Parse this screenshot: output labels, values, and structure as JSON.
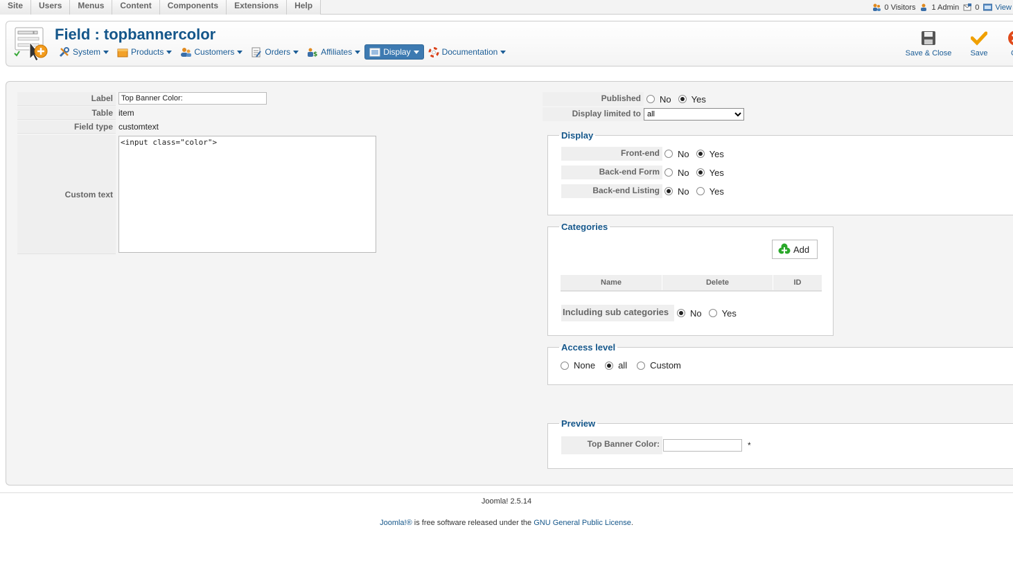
{
  "topmenu": [
    "Site",
    "Users",
    "Menus",
    "Content",
    "Components",
    "Extensions",
    "Help"
  ],
  "status": {
    "visitors": "0 Visitors",
    "admins": "1 Admin",
    "messages": "0",
    "view": "View"
  },
  "header": {
    "title": "Field : topbannercolor",
    "submenu": [
      "System",
      "Products",
      "Customers",
      "Orders",
      "Affiliates",
      "Display",
      "Documentation"
    ],
    "active_submenu": "Display"
  },
  "toolbar": {
    "save_close": "Save & Close",
    "save": "Save",
    "cancel": "Ca"
  },
  "form": {
    "label_key": "Label",
    "label_value": "Top Banner Color:",
    "table_key": "Table",
    "table_value": "item",
    "field_type_key": "Field type",
    "field_type_value": "customtext",
    "custom_text_key": "Custom text",
    "custom_text_value": "<input class=\"color\">"
  },
  "right": {
    "published_key": "Published",
    "published": {
      "no": "No",
      "yes": "Yes",
      "selected": "Yes"
    },
    "display_limited_key": "Display limited to",
    "display_limited_value": "all",
    "display_legend": "Display",
    "frontend_key": "Front-end",
    "frontend_selected": "Yes",
    "backend_form_key": "Back-end Form",
    "backend_form_selected": "Yes",
    "backend_listing_key": "Back-end Listing",
    "backend_listing_selected": "No",
    "no": "No",
    "yes": "Yes",
    "categories_legend": "Categories",
    "add_button": "Add",
    "cat_columns": [
      "Name",
      "Delete",
      "ID"
    ],
    "including_sub_key": "Including sub categories",
    "including_sub_selected": "No",
    "access_legend": "Access level",
    "access_options": [
      "None",
      "all",
      "Custom"
    ],
    "access_selected": "all",
    "preview_legend": "Preview",
    "preview_key": "Top Banner Color:",
    "preview_value": "",
    "preview_required": "*"
  },
  "footer": {
    "version": "Joomla! 2.5.14",
    "joomla_link": "Joomla!®",
    "license_text_1": " is free software released under the ",
    "license_link": "GNU General Public License",
    "license_text_2": "."
  },
  "colors": {
    "title": "#14568a",
    "link": "#1a5c96",
    "active_tab": "#3d7ab1",
    "save_check": "#f0a000",
    "cancel": "#e04a1a"
  }
}
